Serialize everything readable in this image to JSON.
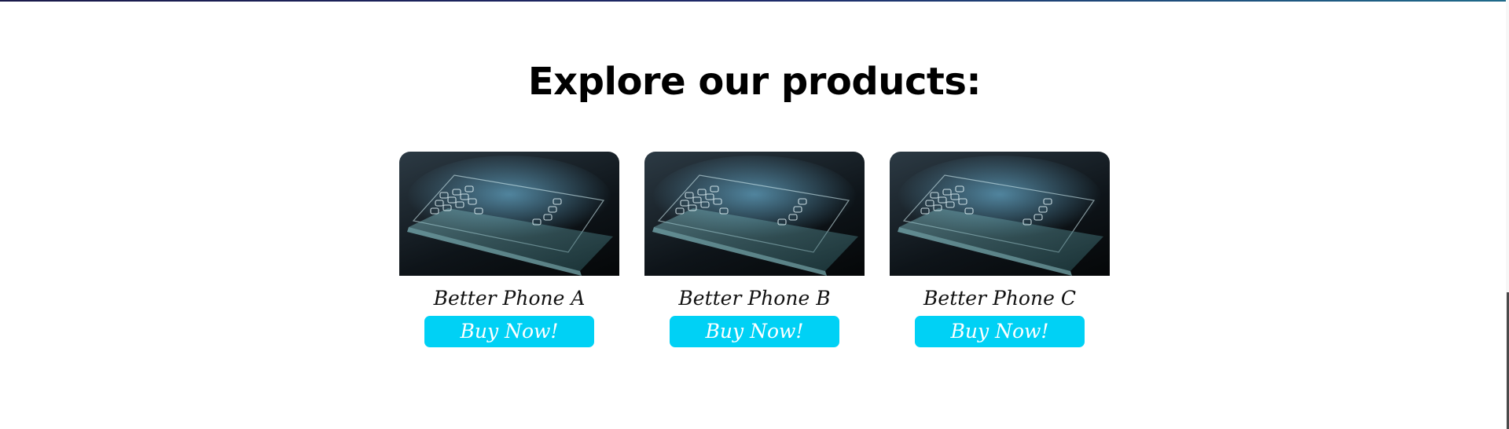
{
  "section": {
    "title": "Explore our products:"
  },
  "products": [
    {
      "name": "Better Phone A",
      "button_label": "Buy Now!"
    },
    {
      "name": "Better Phone B",
      "button_label": "Buy Now!"
    },
    {
      "name": "Better Phone C",
      "button_label": "Buy Now!"
    }
  ],
  "colors": {
    "button_background": "#00d1f5",
    "button_text": "#ffffff",
    "title_text": "#000000"
  }
}
